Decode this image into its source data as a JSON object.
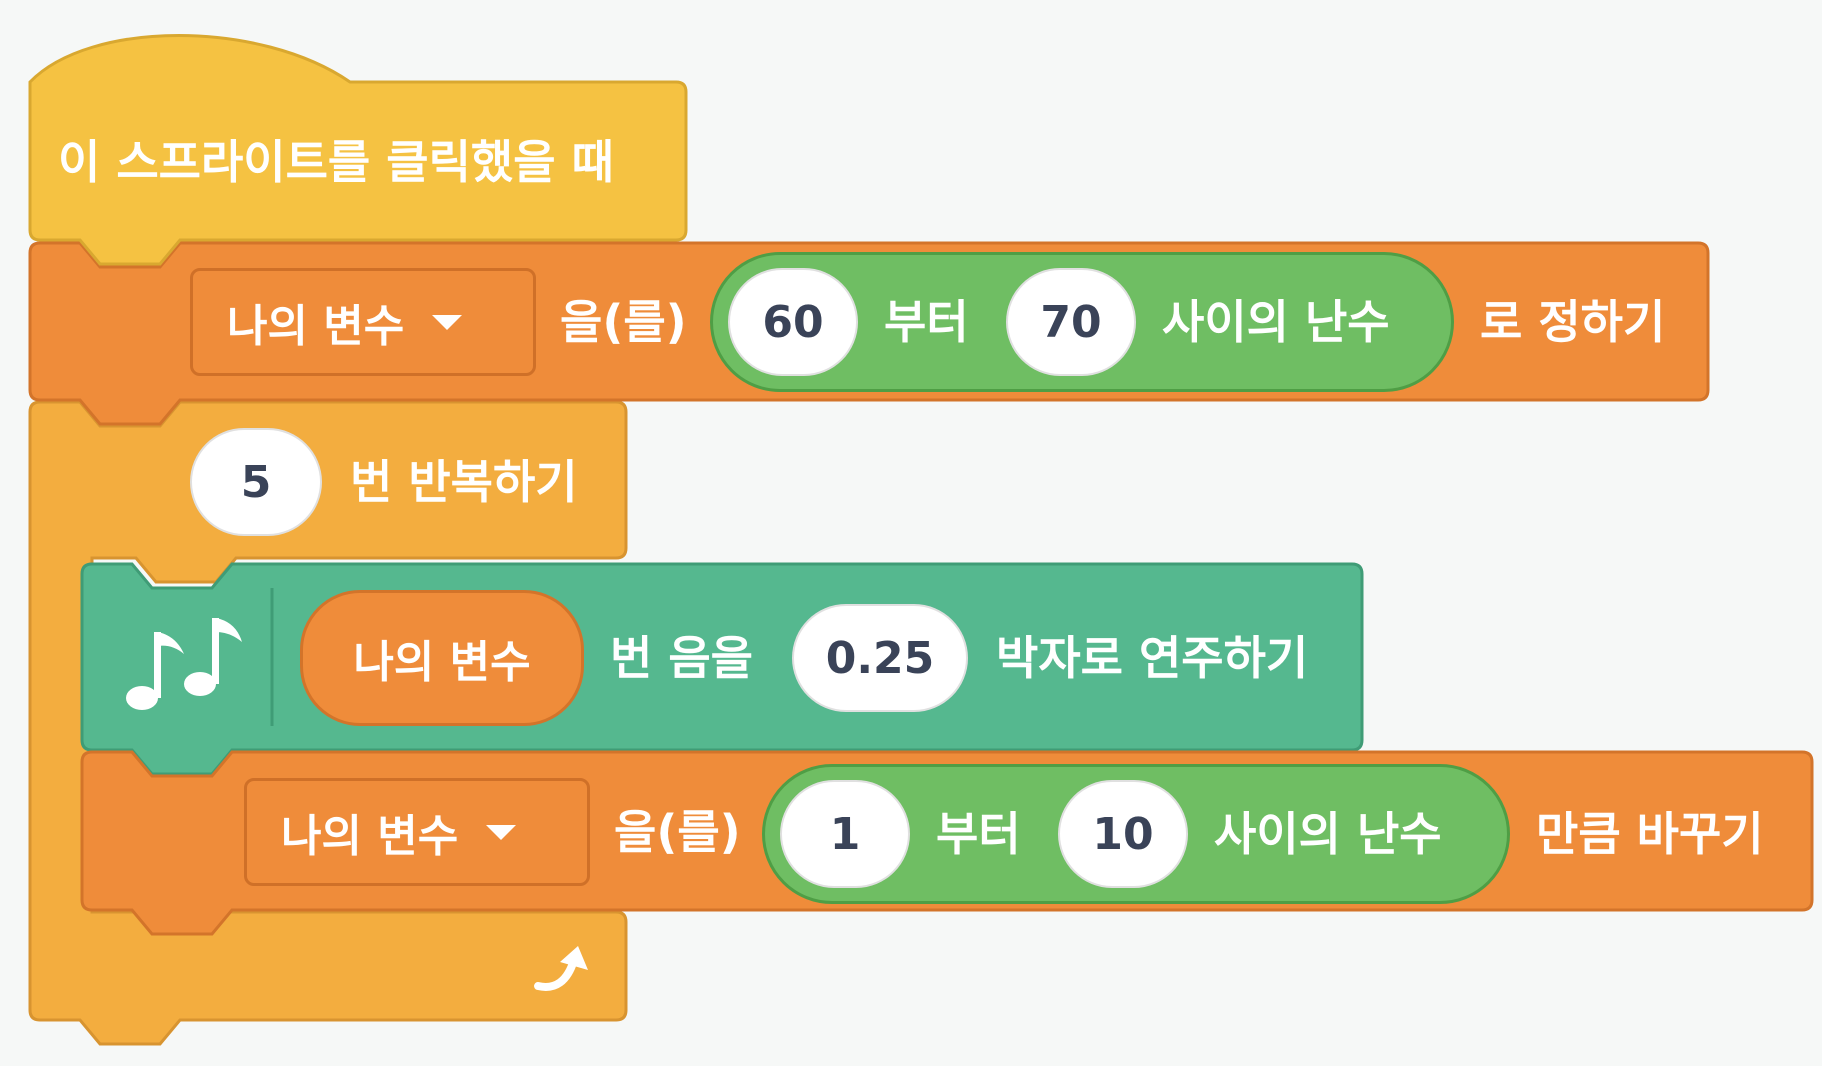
{
  "blocks": {
    "hat": {
      "label": "이 스프라이트를 클릭했을 때"
    },
    "set_var": {
      "variable": "나의 변수",
      "to_label": "을(를)",
      "random_from": "60",
      "from_label": "부터",
      "random_to": "70",
      "random_label": "사이의 난수",
      "suffix": "로 정하기"
    },
    "repeat": {
      "count": "5",
      "label": "번 반복하기"
    },
    "play_note": {
      "note_var": "나의 변수",
      "note_label": "번 음을",
      "beats": "0.25",
      "suffix": "박자로 연주하기"
    },
    "change_var": {
      "variable": "나의 변수",
      "by_label": "을(를)",
      "random_from": "1",
      "from_label": "부터",
      "random_to": "10",
      "random_label": "사이의 난수",
      "suffix": "만큼 바꾸기"
    }
  },
  "colors": {
    "event": "#f5c242",
    "control": "#f3ad3f",
    "variables": "#ef8c3a",
    "operators": "#6fbe63",
    "music": "#55b88f",
    "background": "#f6f8f7"
  }
}
